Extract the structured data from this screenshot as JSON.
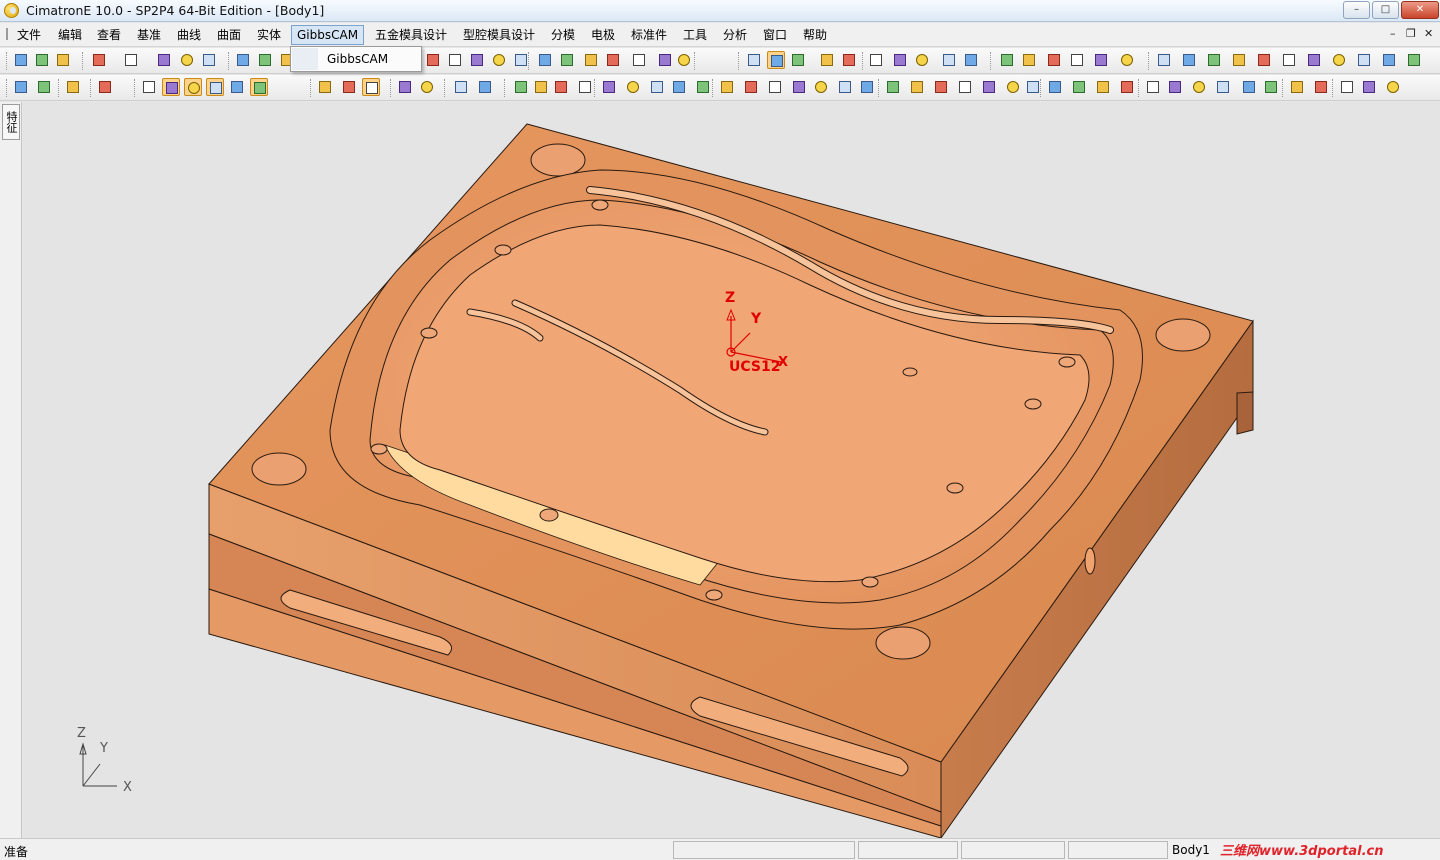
{
  "window": {
    "title": "CimatronE 10.0 - SP2P4 64-Bit Edition - [Body1]",
    "min_glyph": "–",
    "max_glyph": "□",
    "close_glyph": "✕"
  },
  "menu": {
    "items": [
      "文件",
      "编辑",
      "查看",
      "基准",
      "曲线",
      "曲面",
      "实体",
      "GibbsCAM",
      "五金模具设计",
      "型腔模具设计",
      "分模",
      "电极",
      "标准件",
      "工具",
      "分析",
      "窗口",
      "帮助"
    ],
    "active": "GibbsCAM",
    "mdi_min": "–",
    "mdi_restore": "❐",
    "mdi_close": "✕"
  },
  "dropdown": {
    "items": [
      "GibbsCAM"
    ]
  },
  "side_panel": {
    "tab_label": "特征"
  },
  "viewport": {
    "ucs_label": "UCS12",
    "ucs_axes": {
      "x": "X",
      "y": "Y",
      "z": "Z"
    },
    "triad_axes": {
      "x": "X",
      "y": "Y",
      "z": "Z"
    },
    "colors": {
      "background": "#e4e4e4",
      "part_top": "#e69a6a",
      "part_front": "#e28f58",
      "part_side": "#c47a4a",
      "cavity": "#f0a576",
      "highlight": "#ffdca0",
      "ucs": "#e00000"
    }
  },
  "status": {
    "text": "准备",
    "body": "Body1",
    "watermark": "三维网www.3dportal.cn"
  }
}
